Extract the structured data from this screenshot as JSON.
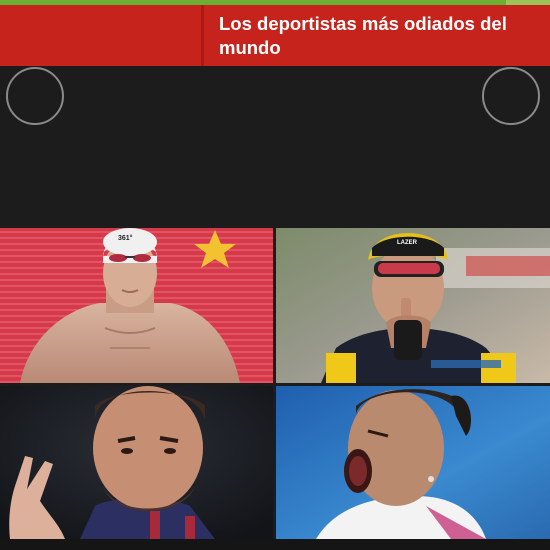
{
  "progress": {
    "value": 0.92
  },
  "header": {
    "title": "Los deportistas más odiados del mundo",
    "background": "#c5231b"
  },
  "slider": {
    "prev_button": "prev-circle",
    "next_button": "next-circle"
  },
  "gallery": {
    "tiles": [
      {
        "name": "swimmer-photo",
        "cap_text": "361°"
      },
      {
        "name": "cyclist-photo",
        "helmet_text": "LAZER"
      },
      {
        "name": "footballer-photo"
      },
      {
        "name": "tennis-player-photo"
      }
    ]
  }
}
